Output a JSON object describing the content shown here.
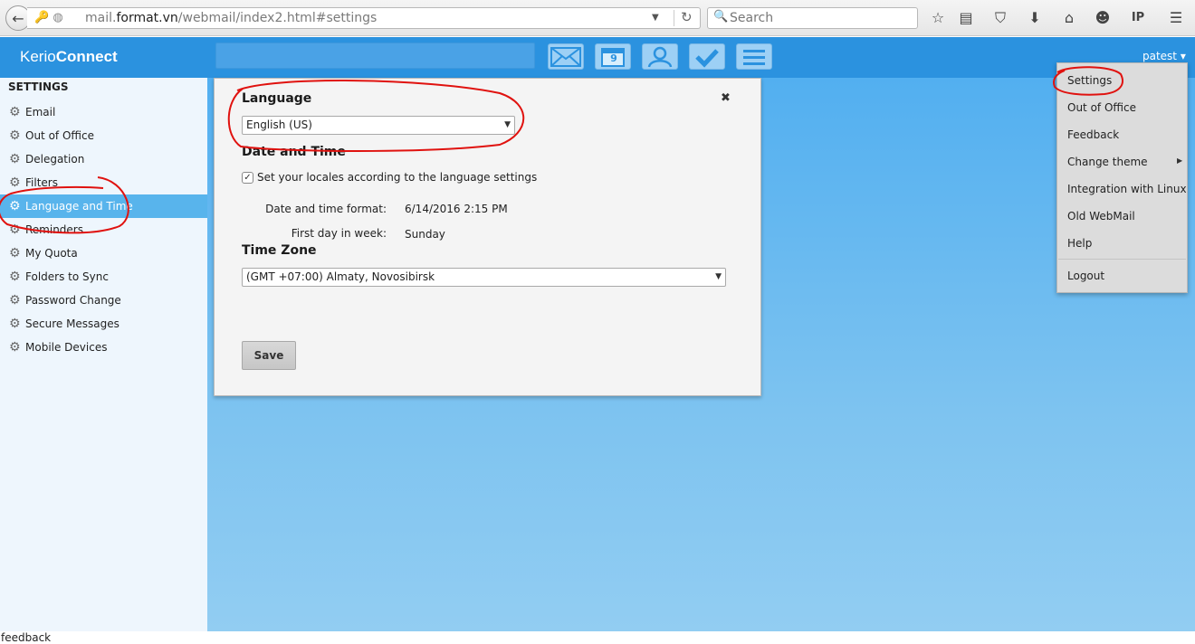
{
  "browser": {
    "url_prefix": "mail.",
    "url_host": "format.vn",
    "url_path": "/webmail/index2.html#settings",
    "search_placeholder": "Search"
  },
  "app": {
    "brand_light": "Kerio",
    "brand_bold": "Connect",
    "user": "patest ▾",
    "calendar_day": "9"
  },
  "sidebar": {
    "title": "SETTINGS",
    "items": [
      {
        "label": "Email"
      },
      {
        "label": "Out of Office"
      },
      {
        "label": "Delegation"
      },
      {
        "label": "Filters"
      },
      {
        "label": "Language and Time",
        "active": true
      },
      {
        "label": "Reminders"
      },
      {
        "label": "My Quota"
      },
      {
        "label": "Folders to Sync"
      },
      {
        "label": "Password Change"
      },
      {
        "label": "Secure Messages"
      },
      {
        "label": "Mobile Devices"
      }
    ]
  },
  "panel": {
    "language_heading": "Language",
    "language_value": "English (US)",
    "datetime_heading": "Date and Time",
    "locale_checkbox_label": "Set your locales according to the language settings",
    "locale_checked": true,
    "format_label": "Date and time format:",
    "format_value": "6/14/2016 2:15 PM",
    "first_day_label": "First day in week:",
    "first_day_value": "Sunday",
    "timezone_heading": "Time Zone",
    "timezone_value": "(GMT +07:00) Almaty, Novosibirsk",
    "save_label": "Save"
  },
  "dropdown": {
    "items": [
      "Settings",
      "Out of Office",
      "Feedback",
      "Change theme",
      "Integration with Linux",
      "Old WebMail",
      "Help",
      "Logout"
    ]
  },
  "status_bar": {
    "text": "feedback"
  },
  "colors": {
    "header": "#2b92df",
    "sidebar_active": "#58b4ec",
    "annotation": "#e0120f"
  }
}
